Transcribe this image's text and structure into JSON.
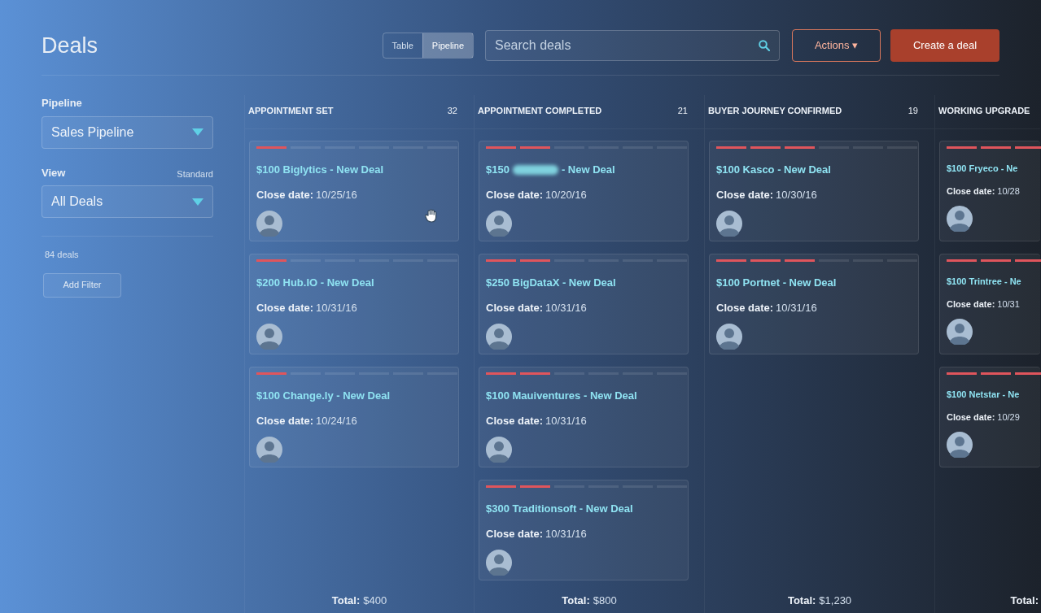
{
  "header": {
    "title": "Deals",
    "view_toggle": [
      {
        "label": "Table",
        "selected": false
      },
      {
        "label": "Pipeline",
        "selected": true
      }
    ],
    "search": {
      "placeholder": "Search deals"
    },
    "actions_button": "Actions ▾",
    "create_button": "Create a deal"
  },
  "sidebar": {
    "pipeline_label": "Pipeline",
    "pipeline_value": "Sales Pipeline",
    "view_label": "View",
    "view_hint": "Standard",
    "view_value": "All Deals",
    "deal_count": "84 deals",
    "add_filter": "Add Filter"
  },
  "columns": [
    {
      "name": "APPOINTMENT SET",
      "count": "32",
      "total_label": "Total:",
      "total": "$400",
      "cards": [
        {
          "title": "$100 Biglytics - New Deal",
          "close_label": "Close date:",
          "date": "10/25/16",
          "level": 0.1667
        },
        {
          "title": "$200 Hub.IO - New Deal",
          "close_label": "Close date:",
          "date": "10/31/16",
          "level": 0.1667
        },
        {
          "title": "$100 Change.ly - New Deal",
          "close_label": "Close date:",
          "date": "10/24/16",
          "level": 0.1667
        }
      ]
    },
    {
      "name": "APPOINTMENT COMPLETED",
      "count": "21",
      "total_label": "Total:",
      "total": "$800",
      "cards": [
        {
          "title": "$150",
          "redacted": true,
          "title_rest": "- New Deal",
          "close_label": "Close date:",
          "date": "10/20/16",
          "level": 0.3333
        },
        {
          "title": "$250 BigDataX - New Deal",
          "close_label": "Close date:",
          "date": "10/31/16",
          "level": 0.3333
        },
        {
          "title": "$100 Mauiventures - New Deal",
          "close_label": "Close date:",
          "date": "10/31/16",
          "level": 0.3333
        },
        {
          "title": "$300 Traditionsoft - New Deal",
          "close_label": "Close date:",
          "date": "10/31/16",
          "level": 0.3333
        }
      ]
    },
    {
      "name": "BUYER JOURNEY CONFIRMED",
      "count": "19",
      "total_label": "Total:",
      "total": "$1,230",
      "cards": [
        {
          "title": "$100 Kasco - New Deal",
          "close_label": "Close date:",
          "date": "10/30/16",
          "level": 0.5
        },
        {
          "title": "$100 Portnet - New Deal",
          "close_label": "Close date:",
          "date": "10/31/16",
          "level": 0.5
        }
      ]
    },
    {
      "name": "WORKING UPGRADE",
      "total_label": "Total:",
      "cards": [
        {
          "title": "$100 Fryeco - Ne",
          "close_label": "Close date:",
          "date": "10/28",
          "level": 0.6667
        },
        {
          "title": "$100 Trintree - Ne",
          "close_label": "Close date:",
          "date": "10/31",
          "level": 0.6667
        },
        {
          "title": "$100 Netstar - Ne",
          "close_label": "Close date:",
          "date": "10/29",
          "level": 0.6667
        }
      ]
    }
  ]
}
